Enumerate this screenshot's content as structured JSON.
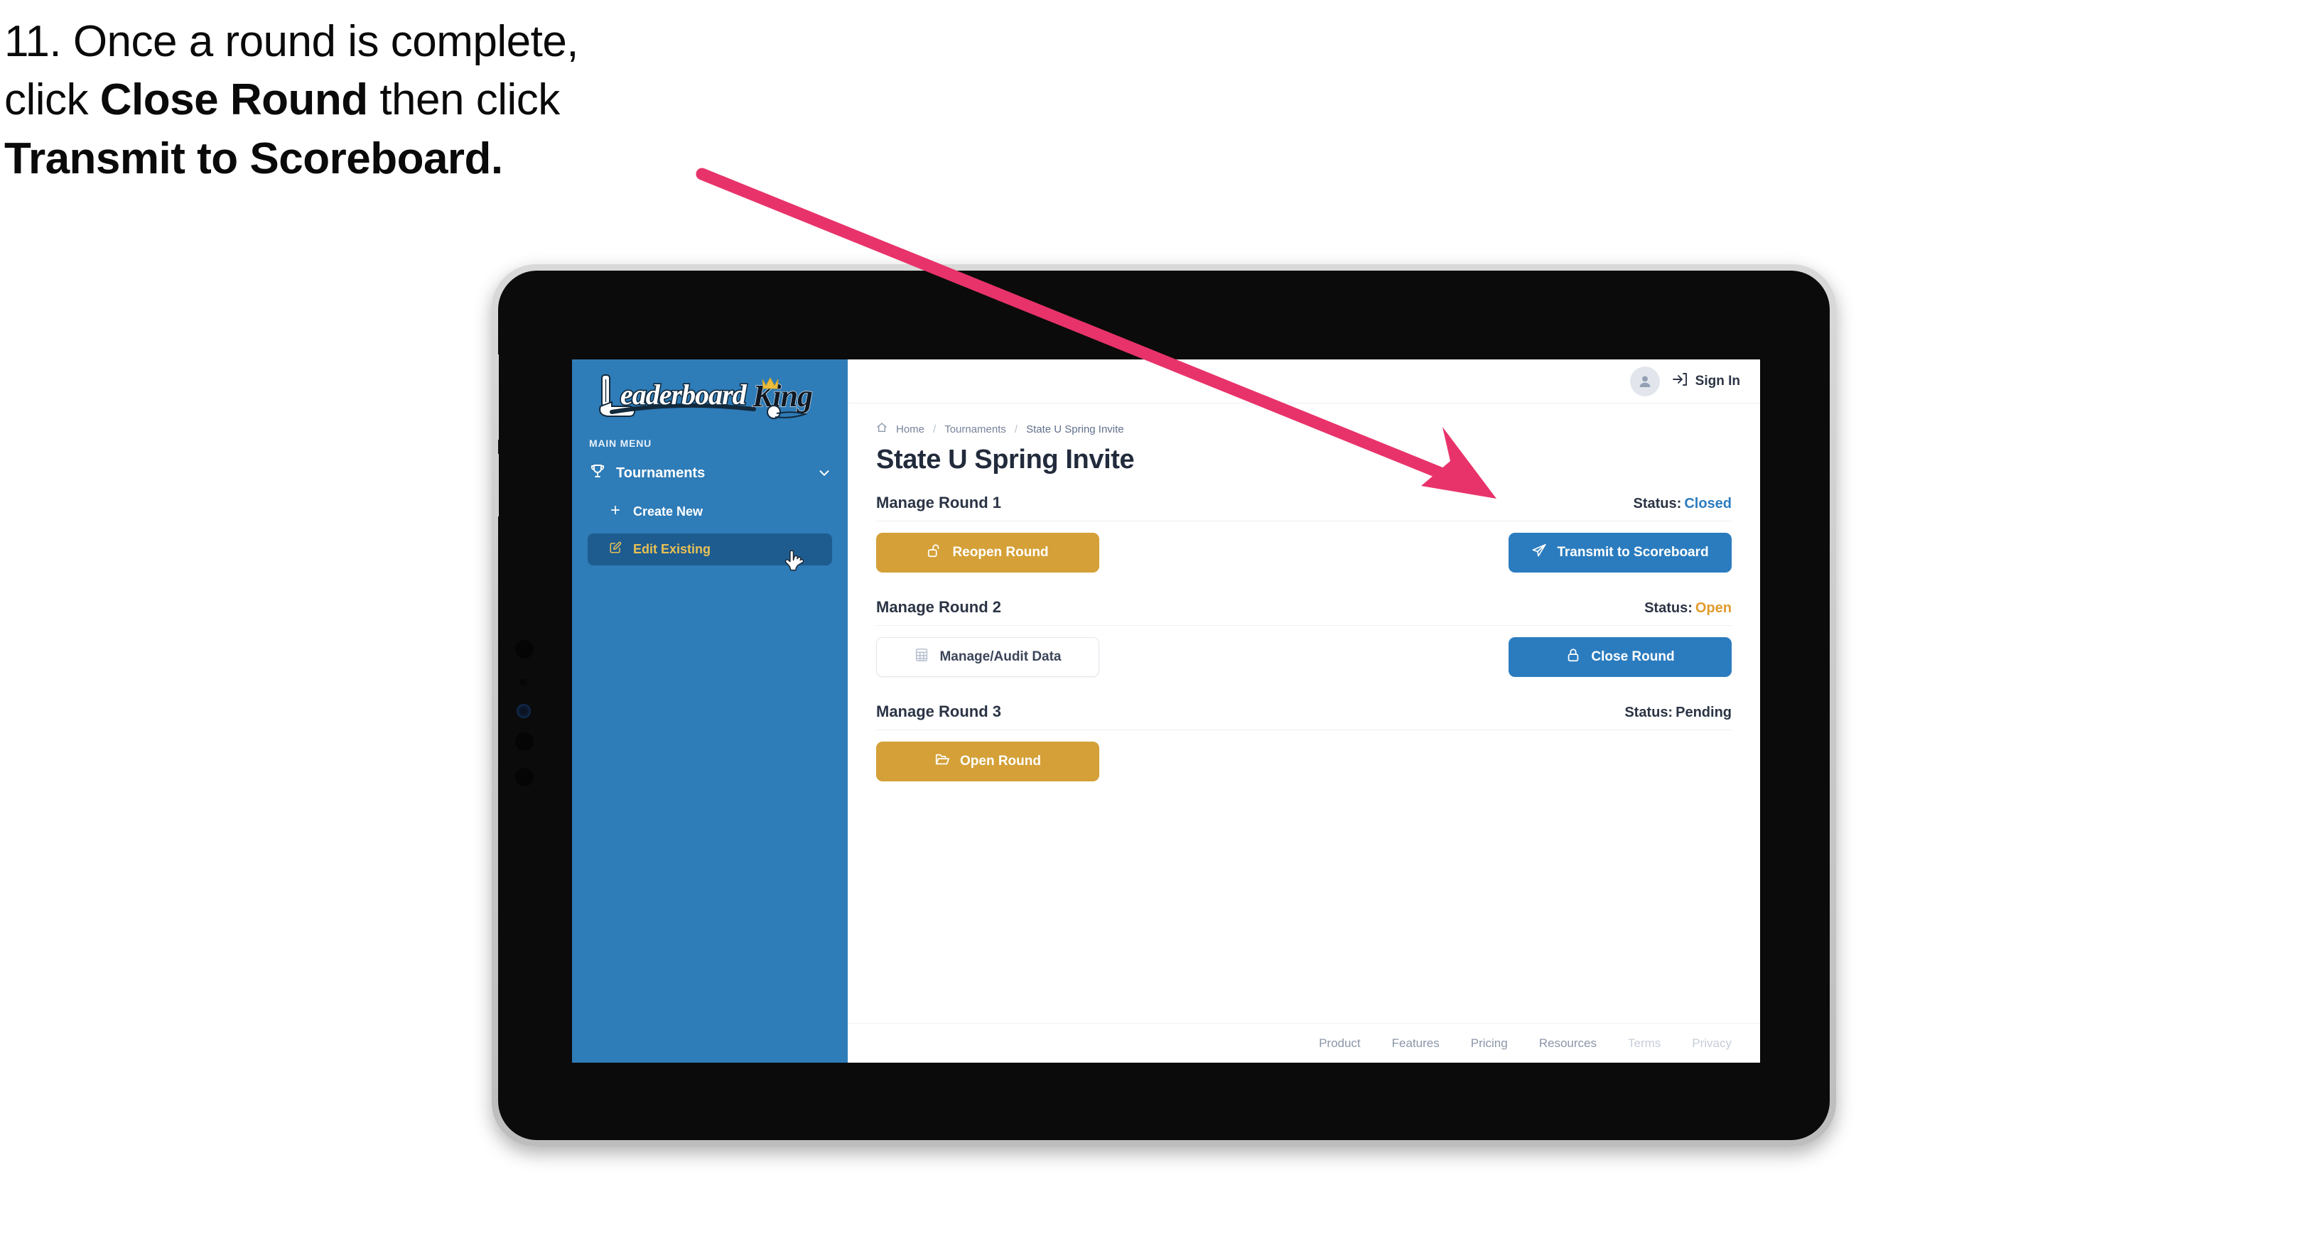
{
  "caption": {
    "line1_prefix": "11. Once a round is complete,",
    "line2_prefix": "click ",
    "line2_bold": "Close Round",
    "line2_suffix": " then click",
    "line3_bold": "Transmit to Scoreboard."
  },
  "annotation": {
    "arrow_color": "#e8336a",
    "arrow_name": "pointer-arrow"
  },
  "sidebar": {
    "logo_primary": "Leaderboard",
    "logo_secondary": "King",
    "section_label": "MAIN MENU",
    "nav": {
      "label": "Tournaments",
      "icon": "trophy-icon",
      "chevron": "chevron-down-icon"
    },
    "sub_items": [
      {
        "label": "Create New",
        "icon": "plus-icon",
        "active": false
      },
      {
        "label": "Edit Existing",
        "icon": "pencil-square-icon",
        "active": true
      }
    ],
    "background_color": "#2e7cb8",
    "active_background_color": "#1e5c90",
    "active_text_color": "#e8c055"
  },
  "topbar": {
    "avatar_icon": "user-avatar-icon",
    "signin_icon": "sign-in-icon",
    "signin_label": "Sign In"
  },
  "breadcrumb": {
    "home_icon": "home-icon",
    "items": [
      "Home",
      "Tournaments",
      "State U Spring Invite"
    ],
    "separator": "/"
  },
  "page": {
    "title": "State U Spring Invite"
  },
  "rounds": [
    {
      "title": "Manage Round 1",
      "status_label": "Status:",
      "status_value": "Closed",
      "status_class": "closed",
      "left_button": {
        "label": "Reopen Round",
        "style": "gold",
        "icon": "unlock-icon"
      },
      "right_button": {
        "label": "Transmit to Scoreboard",
        "style": "blue",
        "icon": "paper-plane-icon"
      }
    },
    {
      "title": "Manage Round 2",
      "status_label": "Status:",
      "status_value": "Open",
      "status_class": "open",
      "left_button": {
        "label": "Manage/Audit Data",
        "style": "ghost",
        "icon": "table-grid-icon"
      },
      "right_button": {
        "label": "Close Round",
        "style": "blue",
        "icon": "lock-icon"
      }
    },
    {
      "title": "Manage Round 3",
      "status_label": "Status:",
      "status_value": "Pending",
      "status_class": "pending",
      "left_button": {
        "label": "Open Round",
        "style": "gold",
        "icon": "folder-open-icon"
      },
      "right_button": null
    }
  ],
  "footer": {
    "links": [
      {
        "label": "Product",
        "muted": false
      },
      {
        "label": "Features",
        "muted": false
      },
      {
        "label": "Pricing",
        "muted": false
      },
      {
        "label": "Resources",
        "muted": false
      },
      {
        "label": "Terms",
        "muted": true
      },
      {
        "label": "Privacy",
        "muted": true
      }
    ]
  },
  "colors": {
    "brand_blue": "#2b7cbf",
    "sidebar_blue": "#2e7cb8",
    "gold": "#d4a037",
    "status_open": "#e09b2d",
    "status_closed": "#2b7cbf",
    "arrow_pink": "#e8336a"
  }
}
